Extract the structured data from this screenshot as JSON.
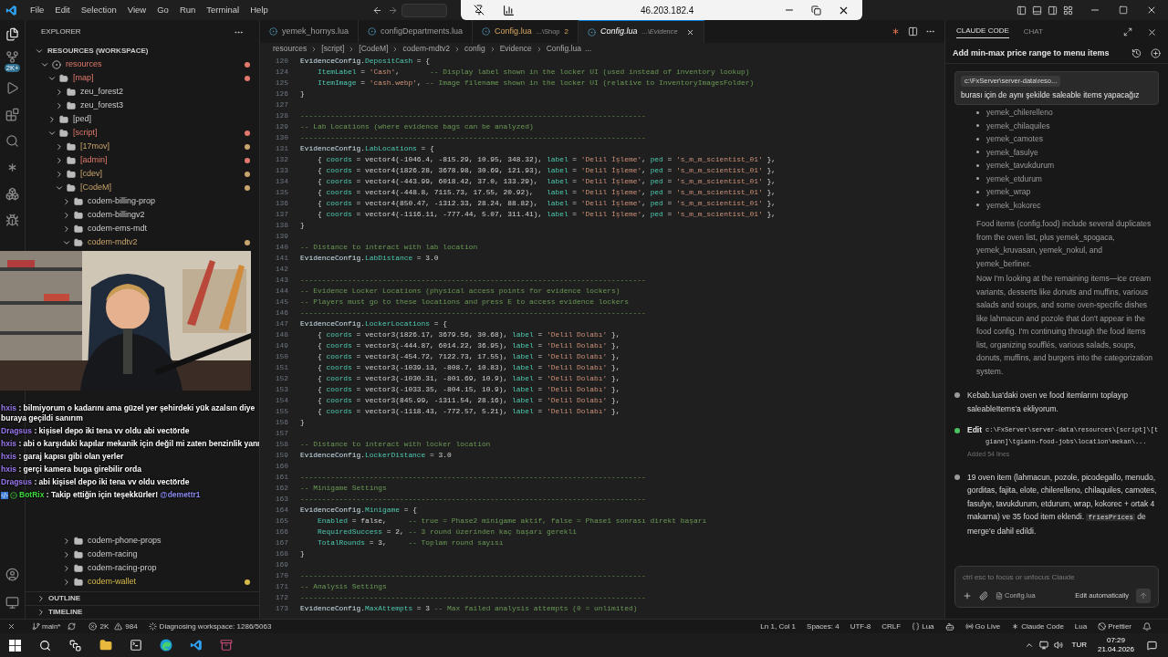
{
  "menu": [
    "File",
    "Edit",
    "Selection",
    "View",
    "Go",
    "Run",
    "Terminal",
    "Help"
  ],
  "remote_bar": {
    "address": "46.203.182.4"
  },
  "activity_bar": {
    "badge": "2K+"
  },
  "sidebar": {
    "title": "EXPLORER",
    "workspace": "RESOURCES (WORKSPACE)",
    "tree": [
      {
        "label": "resources",
        "kind": "root",
        "expanded": true,
        "color": "#e0796b",
        "dot": true,
        "children": [
          {
            "label": "[map]",
            "kind": "folder",
            "expanded": true,
            "color": "#e0796b",
            "dot": true,
            "children": [
              {
                "label": "zeu_forest2",
                "kind": "folder",
                "expanded": false,
                "dot": false
              },
              {
                "label": "zeu_forest3",
                "kind": "folder",
                "expanded": false,
                "dot": false
              }
            ]
          },
          {
            "label": "[ped]",
            "kind": "folder",
            "expanded": false,
            "dot": false
          },
          {
            "label": "[script]",
            "kind": "folder",
            "expanded": true,
            "color": "#e0796b",
            "dot": true,
            "children": [
              {
                "label": "[17mov]",
                "kind": "folder",
                "expanded": false,
                "color": "#c9a46c",
                "dot": true
              },
              {
                "label": "[admin]",
                "kind": "folder",
                "expanded": false,
                "color": "#e0796b",
                "dot": true
              },
              {
                "label": "[cdev]",
                "kind": "folder",
                "expanded": false,
                "color": "#c9a46c",
                "dot": true
              },
              {
                "label": "[CodeM]",
                "kind": "folder",
                "expanded": true,
                "color": "#c9a46c",
                "dot": true,
                "children": [
                  {
                    "label": "codem-billing-prop",
                    "kind": "folder",
                    "expanded": false,
                    "dot": false
                  },
                  {
                    "label": "codem-billingv2",
                    "kind": "folder",
                    "expanded": false,
                    "dot": false
                  },
                  {
                    "label": "codem-ems-mdt",
                    "kind": "folder",
                    "expanded": false,
                    "dot": false
                  },
                  {
                    "label": "codem-mdtv2",
                    "kind": "folder",
                    "expanded": true,
                    "color": "#c9a46c",
                    "dot": true
                  },
                  {
                    "label": "codem-phone-props",
                    "kind": "folder",
                    "expanded": false,
                    "dot": false
                  },
                  {
                    "label": "codem-racing",
                    "kind": "folder",
                    "expanded": false,
                    "dot": false
                  },
                  {
                    "label": "codem-racing-prop",
                    "kind": "folder",
                    "expanded": false,
                    "dot": false
                  },
                  {
                    "label": "codem-wallet",
                    "kind": "folder",
                    "expanded": false,
                    "color": "#d7ba4a",
                    "dot": true
                  }
                ]
              }
            ]
          }
        ]
      }
    ],
    "sections": [
      {
        "label": "OUTLINE",
        "expanded": false
      },
      {
        "label": "TIMELINE",
        "expanded": false
      }
    ]
  },
  "chat_overlay": [
    {
      "kind": "viewer",
      "user": "hxis",
      "separator": ":",
      "text": "bilmiyorum o kadarını ama güzel yer şehirdeki yük azalsın diye buraya geçildi sanırım"
    },
    {
      "kind": "viewer",
      "user": "Dragsus",
      "separator": ":",
      "text": "kişisel depo iki tena vv oldu abi vectörde"
    },
    {
      "kind": "viewer",
      "user": "hxis",
      "separator": ":",
      "text": "abi o karşıdaki kapılar mekanik için değil mi zaten benzinlik yanı"
    },
    {
      "kind": "viewer",
      "user": "hxis",
      "separator": ":",
      "text": "garaj kapısı gibi olan yerler"
    },
    {
      "kind": "viewer",
      "user": "hxis",
      "separator": ":",
      "text": "gerçi kamera buga girebilir orda"
    },
    {
      "kind": "viewer",
      "user": "Dragsus",
      "separator": ":",
      "text": "abi kişisel depo iki tena vv oldu vectörde"
    },
    {
      "kind": "bot",
      "user": "BotRix",
      "separator": ":",
      "text": "Takip ettiğin için teşekkürler!",
      "mention": "@demettr1"
    }
  ],
  "tabs": [
    {
      "label": "yemek_hornys.lua",
      "selected": false,
      "modified": false
    },
    {
      "label": "configDepartments.lua",
      "selected": false,
      "modified": false
    },
    {
      "label": "Config.lua",
      "path": "...\\Shop",
      "problems": "2",
      "selected": false,
      "modified": true
    },
    {
      "label": "Config.lua",
      "path": "...\\Evidence",
      "selected": true,
      "modified": false
    }
  ],
  "breadcrumb": [
    "resources",
    "[script]",
    "[CodeM]",
    "codem-mdtv2",
    "config",
    "Evidence",
    "Config.lua",
    "..."
  ],
  "code": [
    {
      "n": "120",
      "tokens": [
        {
          "kind": "var",
          "text": "EvidenceConfig."
        },
        {
          "kind": "field",
          "text": "DepositCash"
        },
        {
          "kind": "plain",
          "text": " = {"
        }
      ]
    },
    {
      "n": "124",
      "tokens": [
        {
          "kind": "field",
          "text": "    ItemLabel"
        },
        {
          "kind": "plain",
          "text": " = "
        },
        {
          "kind": "str",
          "text": "'Cash'"
        },
        {
          "kind": "plain",
          "text": ",       "
        },
        {
          "kind": "comment",
          "text": "-- Display label shown in the locker UI (used instead of inventory lookup)"
        }
      ]
    },
    {
      "n": "125",
      "tokens": [
        {
          "kind": "field",
          "text": "    ItemImage"
        },
        {
          "kind": "plain",
          "text": " = "
        },
        {
          "kind": "str",
          "text": "'cash.webp'"
        },
        {
          "kind": "plain",
          "text": ", "
        },
        {
          "kind": "comment",
          "text": "-- Image filename shown in the locker UI (relative to InventoryImagesFolder)"
        }
      ]
    },
    {
      "n": "126",
      "tokens": [
        {
          "kind": "plain",
          "text": "}"
        }
      ]
    },
    {
      "n": "127"
    },
    {
      "n": "128",
      "tokens": [
        {
          "kind": "comment",
          "text": "--------------------------------------------------------------------------------"
        }
      ]
    },
    {
      "n": "129",
      "tokens": [
        {
          "kind": "comment",
          "text": "-- Lab Locations (where evidence bags can be analyzed)"
        }
      ]
    },
    {
      "n": "130",
      "tokens": [
        {
          "kind": "comment",
          "text": "--------------------------------------------------------------------------------"
        }
      ]
    },
    {
      "n": "131",
      "tokens": [
        {
          "kind": "var",
          "text": "EvidenceConfig."
        },
        {
          "kind": "field",
          "text": "LabLocations"
        },
        {
          "kind": "plain",
          "text": " = {"
        }
      ]
    },
    {
      "n": "132",
      "tokens": [
        {
          "kind": "plain",
          "text": "    { "
        },
        {
          "kind": "field",
          "text": "coords"
        },
        {
          "kind": "plain",
          "text": " = vector4(-1046.4, -815.29, 10.95, 348.32), "
        },
        {
          "kind": "field",
          "text": "label"
        },
        {
          "kind": "plain",
          "text": " = "
        },
        {
          "kind": "str",
          "text": "'Delil İşleme'"
        },
        {
          "kind": "plain",
          "text": ", "
        },
        {
          "kind": "field",
          "text": "ped"
        },
        {
          "kind": "plain",
          "text": " = "
        },
        {
          "kind": "str",
          "text": "'s_m_m_scientist_01'"
        },
        {
          "kind": "plain",
          "text": " },"
        }
      ]
    },
    {
      "n": "133",
      "tokens": [
        {
          "kind": "plain",
          "text": "    { "
        },
        {
          "kind": "field",
          "text": "coords"
        },
        {
          "kind": "plain",
          "text": " = vector4(1826.28, 3678.98, 30.69, 121.93), "
        },
        {
          "kind": "field",
          "text": "label"
        },
        {
          "kind": "plain",
          "text": " = "
        },
        {
          "kind": "str",
          "text": "'Delil İşleme'"
        },
        {
          "kind": "plain",
          "text": ", "
        },
        {
          "kind": "field",
          "text": "ped"
        },
        {
          "kind": "plain",
          "text": " = "
        },
        {
          "kind": "str",
          "text": "'s_m_m_scientist_01'"
        },
        {
          "kind": "plain",
          "text": " },"
        }
      ]
    },
    {
      "n": "134",
      "tokens": [
        {
          "kind": "plain",
          "text": "    { "
        },
        {
          "kind": "field",
          "text": "coords"
        },
        {
          "kind": "plain",
          "text": " = vector4(-443.99, 6018.42, 37.0, 133.29),  "
        },
        {
          "kind": "field",
          "text": "label"
        },
        {
          "kind": "plain",
          "text": " = "
        },
        {
          "kind": "str",
          "text": "'Delil İşleme'"
        },
        {
          "kind": "plain",
          "text": ", "
        },
        {
          "kind": "field",
          "text": "ped"
        },
        {
          "kind": "plain",
          "text": " = "
        },
        {
          "kind": "str",
          "text": "'s_m_m_scientist_01'"
        },
        {
          "kind": "plain",
          "text": " },"
        }
      ]
    },
    {
      "n": "135",
      "tokens": [
        {
          "kind": "plain",
          "text": "    { "
        },
        {
          "kind": "field",
          "text": "coords"
        },
        {
          "kind": "plain",
          "text": " = vector4(-448.8, 7115.73, 17.55, 20.92),   "
        },
        {
          "kind": "field",
          "text": "label"
        },
        {
          "kind": "plain",
          "text": " = "
        },
        {
          "kind": "str",
          "text": "'Delil İşleme'"
        },
        {
          "kind": "plain",
          "text": ", "
        },
        {
          "kind": "field",
          "text": "ped"
        },
        {
          "kind": "plain",
          "text": " = "
        },
        {
          "kind": "str",
          "text": "'s_m_m_scientist_01'"
        },
        {
          "kind": "plain",
          "text": " },"
        }
      ]
    },
    {
      "n": "136",
      "tokens": [
        {
          "kind": "plain",
          "text": "    { "
        },
        {
          "kind": "field",
          "text": "coords"
        },
        {
          "kind": "plain",
          "text": " = vector4(850.47, -1312.33, 28.24, 88.82),  "
        },
        {
          "kind": "field",
          "text": "label"
        },
        {
          "kind": "plain",
          "text": " = "
        },
        {
          "kind": "str",
          "text": "'Delil İşleme'"
        },
        {
          "kind": "plain",
          "text": ", "
        },
        {
          "kind": "field",
          "text": "ped"
        },
        {
          "kind": "plain",
          "text": " = "
        },
        {
          "kind": "str",
          "text": "'s_m_m_scientist_01'"
        },
        {
          "kind": "plain",
          "text": " },"
        }
      ]
    },
    {
      "n": "137",
      "tokens": [
        {
          "kind": "plain",
          "text": "    { "
        },
        {
          "kind": "field",
          "text": "coords"
        },
        {
          "kind": "plain",
          "text": " = vector4(-1116.11, -777.44, 5.07, 311.41), "
        },
        {
          "kind": "field",
          "text": "label"
        },
        {
          "kind": "plain",
          "text": " = "
        },
        {
          "kind": "str",
          "text": "'Delil İşleme'"
        },
        {
          "kind": "plain",
          "text": ", "
        },
        {
          "kind": "field",
          "text": "ped"
        },
        {
          "kind": "plain",
          "text": " = "
        },
        {
          "kind": "str",
          "text": "'s_m_m_scientist_01'"
        },
        {
          "kind": "plain",
          "text": " },"
        }
      ]
    },
    {
      "n": "138",
      "tokens": [
        {
          "kind": "plain",
          "text": "}"
        }
      ]
    },
    {
      "n": "139"
    },
    {
      "n": "140",
      "tokens": [
        {
          "kind": "comment",
          "text": "-- Distance to interact with lab location"
        }
      ]
    },
    {
      "n": "141",
      "tokens": [
        {
          "kind": "var",
          "text": "EvidenceConfig."
        },
        {
          "kind": "field",
          "text": "LabDistance"
        },
        {
          "kind": "plain",
          "text": " = 3.0"
        }
      ]
    },
    {
      "n": "142"
    },
    {
      "n": "143",
      "tokens": [
        {
          "kind": "comment",
          "text": "--------------------------------------------------------------------------------"
        }
      ]
    },
    {
      "n": "144",
      "tokens": [
        {
          "kind": "comment",
          "text": "-- Evidence Locker Locations (physical access points for evidence lockers)"
        }
      ]
    },
    {
      "n": "145",
      "tokens": [
        {
          "kind": "comment",
          "text": "-- Players must go to these locations and press E to access evidence lockers"
        }
      ]
    },
    {
      "n": "146",
      "tokens": [
        {
          "kind": "comment",
          "text": "--------------------------------------------------------------------------------"
        }
      ]
    },
    {
      "n": "147",
      "tokens": [
        {
          "kind": "var",
          "text": "EvidenceConfig."
        },
        {
          "kind": "field",
          "text": "LockerLocations"
        },
        {
          "kind": "plain",
          "text": " = {"
        }
      ]
    },
    {
      "n": "148",
      "tokens": [
        {
          "kind": "plain",
          "text": "    { "
        },
        {
          "kind": "field",
          "text": "coords"
        },
        {
          "kind": "plain",
          "text": " = vector3(1826.17, 3679.56, 30.68), "
        },
        {
          "kind": "field",
          "text": "label"
        },
        {
          "kind": "plain",
          "text": " = "
        },
        {
          "kind": "str",
          "text": "'Delil Dolabı'"
        },
        {
          "kind": "plain",
          "text": " },"
        }
      ]
    },
    {
      "n": "149",
      "tokens": [
        {
          "kind": "plain",
          "text": "    { "
        },
        {
          "kind": "field",
          "text": "coords"
        },
        {
          "kind": "plain",
          "text": " = vector3(-444.87, 6014.22, 36.95), "
        },
        {
          "kind": "field",
          "text": "label"
        },
        {
          "kind": "plain",
          "text": " = "
        },
        {
          "kind": "str",
          "text": "'Delil Dolabı'"
        },
        {
          "kind": "plain",
          "text": " },"
        }
      ]
    },
    {
      "n": "150",
      "tokens": [
        {
          "kind": "plain",
          "text": "    { "
        },
        {
          "kind": "field",
          "text": "coords"
        },
        {
          "kind": "plain",
          "text": " = vector3(-454.72, 7122.73, 17.55), "
        },
        {
          "kind": "field",
          "text": "label"
        },
        {
          "kind": "plain",
          "text": " = "
        },
        {
          "kind": "str",
          "text": "'Delil Dolabı'"
        },
        {
          "kind": "plain",
          "text": " },"
        }
      ]
    },
    {
      "n": "151",
      "tokens": [
        {
          "kind": "plain",
          "text": "    { "
        },
        {
          "kind": "field",
          "text": "coords"
        },
        {
          "kind": "plain",
          "text": " = vector3(-1039.13, -808.7, 10.83), "
        },
        {
          "kind": "field",
          "text": "label"
        },
        {
          "kind": "plain",
          "text": " = "
        },
        {
          "kind": "str",
          "text": "'Delil Dolabı'"
        },
        {
          "kind": "plain",
          "text": " },"
        }
      ]
    },
    {
      "n": "152",
      "tokens": [
        {
          "kind": "plain",
          "text": "    { "
        },
        {
          "kind": "field",
          "text": "coords"
        },
        {
          "kind": "plain",
          "text": " = vector3(-1030.31, -801.69, 10.9), "
        },
        {
          "kind": "field",
          "text": "label"
        },
        {
          "kind": "plain",
          "text": " = "
        },
        {
          "kind": "str",
          "text": "'Delil Dolabı'"
        },
        {
          "kind": "plain",
          "text": " },"
        }
      ]
    },
    {
      "n": "153",
      "tokens": [
        {
          "kind": "plain",
          "text": "    { "
        },
        {
          "kind": "field",
          "text": "coords"
        },
        {
          "kind": "plain",
          "text": " = vector3(-1033.35, -804.15, 10.9), "
        },
        {
          "kind": "field",
          "text": "label"
        },
        {
          "kind": "plain",
          "text": " = "
        },
        {
          "kind": "str",
          "text": "'Delil Dolabı'"
        },
        {
          "kind": "plain",
          "text": " },"
        }
      ]
    },
    {
      "n": "154",
      "tokens": [
        {
          "kind": "plain",
          "text": "    { "
        },
        {
          "kind": "field",
          "text": "coords"
        },
        {
          "kind": "plain",
          "text": " = vector3(845.99, -1311.54, 28.16), "
        },
        {
          "kind": "field",
          "text": "label"
        },
        {
          "kind": "plain",
          "text": " = "
        },
        {
          "kind": "str",
          "text": "'Delil Dolabı'"
        },
        {
          "kind": "plain",
          "text": " },"
        }
      ]
    },
    {
      "n": "155",
      "tokens": [
        {
          "kind": "plain",
          "text": "    { "
        },
        {
          "kind": "field",
          "text": "coords"
        },
        {
          "kind": "plain",
          "text": " = vector3(-1118.43, -772.57, 5.21), "
        },
        {
          "kind": "field",
          "text": "label"
        },
        {
          "kind": "plain",
          "text": " = "
        },
        {
          "kind": "str",
          "text": "'Delil Dolabı'"
        },
        {
          "kind": "plain",
          "text": " },"
        }
      ]
    },
    {
      "n": "156",
      "tokens": [
        {
          "kind": "plain",
          "text": "}"
        }
      ]
    },
    {
      "n": "157"
    },
    {
      "n": "158",
      "tokens": [
        {
          "kind": "comment",
          "text": "-- Distance to interact with locker location"
        }
      ]
    },
    {
      "n": "159",
      "tokens": [
        {
          "kind": "var",
          "text": "EvidenceConfig."
        },
        {
          "kind": "field",
          "text": "LockerDistance"
        },
        {
          "kind": "plain",
          "text": " = 3.0"
        }
      ]
    },
    {
      "n": "160"
    },
    {
      "n": "161",
      "tokens": [
        {
          "kind": "comment",
          "text": "--------------------------------------------------------------------------------"
        }
      ]
    },
    {
      "n": "162",
      "tokens": [
        {
          "kind": "comment",
          "text": "-- Minigame Settings"
        }
      ]
    },
    {
      "n": "163",
      "tokens": [
        {
          "kind": "comment",
          "text": "--------------------------------------------------------------------------------"
        }
      ]
    },
    {
      "n": "164",
      "tokens": [
        {
          "kind": "var",
          "text": "EvidenceConfig."
        },
        {
          "kind": "field",
          "text": "Minigame"
        },
        {
          "kind": "plain",
          "text": " = {"
        }
      ]
    },
    {
      "n": "165",
      "tokens": [
        {
          "kind": "field",
          "text": "    Enabled"
        },
        {
          "kind": "plain",
          "text": " = false,     "
        },
        {
          "kind": "comment",
          "text": "-- true = Phase2 minigame aktif, false = Phase1 sonrası direkt başarı"
        }
      ]
    },
    {
      "n": "166",
      "tokens": [
        {
          "kind": "field",
          "text": "    RequiredSuccess"
        },
        {
          "kind": "plain",
          "text": " = 2, "
        },
        {
          "kind": "comment",
          "text": "-- 3 round üzerinden kaç başarı gerekli"
        }
      ]
    },
    {
      "n": "167",
      "tokens": [
        {
          "kind": "field",
          "text": "    TotalRounds"
        },
        {
          "kind": "plain",
          "text": " = 3,     "
        },
        {
          "kind": "comment",
          "text": "-- Toplam round sayısı"
        }
      ]
    },
    {
      "n": "168",
      "tokens": [
        {
          "kind": "plain",
          "text": "}"
        }
      ]
    },
    {
      "n": "169"
    },
    {
      "n": "170",
      "tokens": [
        {
          "kind": "comment",
          "text": "--------------------------------------------------------------------------------"
        }
      ]
    },
    {
      "n": "171",
      "tokens": [
        {
          "kind": "comment",
          "text": "-- Analysis Settings"
        }
      ]
    },
    {
      "n": "172",
      "tokens": [
        {
          "kind": "comment",
          "text": "--------------------------------------------------------------------------------"
        }
      ]
    },
    {
      "n": "173",
      "tokens": [
        {
          "kind": "var",
          "text": "EvidenceConfig."
        },
        {
          "kind": "field",
          "text": "MaxAttempts"
        },
        {
          "kind": "plain",
          "text": " = 3 "
        },
        {
          "kind": "comment",
          "text": "-- Max failed analysis attempts (0 = unlimited)"
        }
      ]
    }
  ],
  "claude": {
    "tabs": [
      {
        "label": "CLAUDE CODE",
        "selected": true
      },
      {
        "label": "CHAT",
        "selected": false
      }
    ],
    "title": "Add min-max price range to menu items",
    "user_message": {
      "file": "c:\\FxServer\\server-data\\reso...",
      "text": "burası için de aynı şekilde saleable items yapacağız"
    },
    "bullets": [
      "yemek_chilerelleno",
      "yemek_chilaquiles",
      "yemek_camotes",
      "yemek_fasulye",
      "yemek_tavukdurum",
      "yemek_etdurum",
      "yemek_wrap",
      "yemek_kokorec"
    ],
    "paragraphs": [
      "Food items (config.food) include several duplicates from the oven list, plus yemek_spogaca, yemek_kruvasan, yemek_nokul, and yemek_berliner.",
      "Now I'm looking at the remaining items—ice cream variants, desserts like donuts and muffins, various salads and soups, and some oven-specific dishes like lahmacun and pozole that don't appear in the food config. I'm continuing through the food items list, organizing soufflés, various salads, soups, donuts, muffins, and burgers into the categorization system."
    ],
    "steps": [
      {
        "kind": "text",
        "color": "#9a9a9a",
        "text": "Kebab.lua'daki oven ve food itemlarını toplayıp saleableItems'a ekliyorum."
      },
      {
        "kind": "edit",
        "color": "#4cc262",
        "label": "Edit",
        "path": "c:\\FxServer\\server-data\\resources\\[script]\\[tgiann]\\tgiann-food-jobs\\location\\mekan\\...",
        "note": "Added 54 lines"
      },
      {
        "kind": "text",
        "color": "#9a9a9a",
        "text": "19 oven item (lahmacun, pozole, picodegallo, menudo, gorditas, fajita, elote, chilerelleno, chilaquiles, camotes, fasulye, tavukdurum, etdurum, wrap, kokorec + ortak 4 makarna) ve 35 food item eklendi.",
        "code": "friesPrices",
        "after": " de merge'e dahil edildi."
      }
    ],
    "input": {
      "placeholder": "ctrl esc to focus or unfocus Claude"
    },
    "toolbar": {
      "file": "Config.lua",
      "mode": "Edit automatically"
    }
  },
  "status_bar": {
    "branch": "main*",
    "errors": "2K",
    "warnings": "984",
    "task": "Diagnosing workspace: 1286/5063",
    "right": [
      "Ln 1, Col 1",
      "Spaces: 4",
      "UTF-8",
      "CRLF"
    ],
    "language": "Lua",
    "go_live": "Go Live",
    "claude": "Claude Code",
    "lua": "Lua",
    "prettier": "Prettier"
  },
  "taskbar": {
    "language": "TUR",
    "time": "07:29",
    "date": "21.04.2026"
  }
}
